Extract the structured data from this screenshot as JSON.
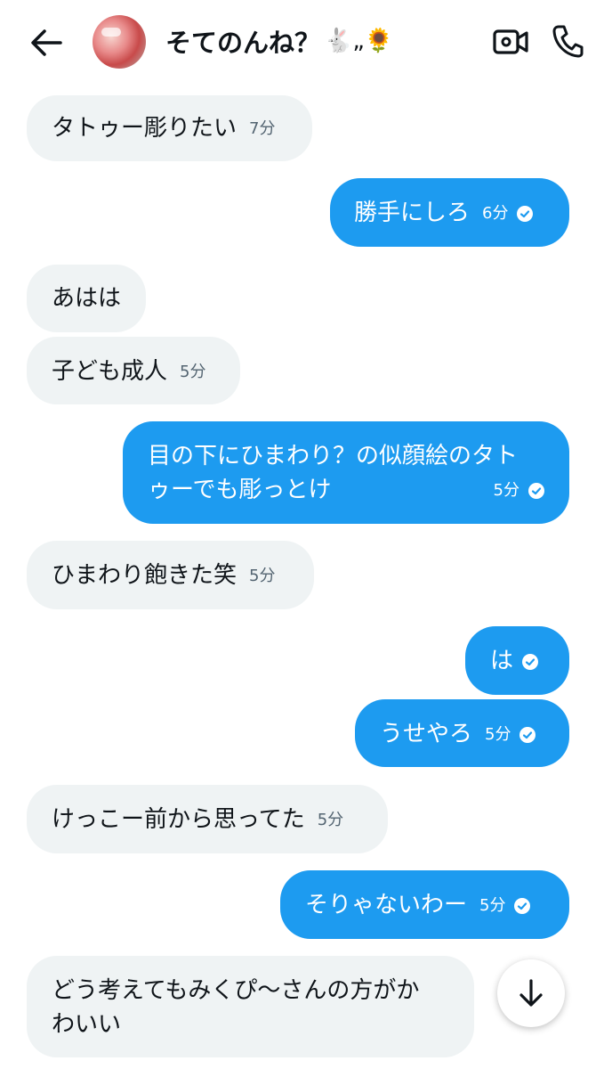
{
  "header": {
    "title": "そてのんね？",
    "title_emojis": "🐇„🌻"
  },
  "messages": [
    {
      "text": "タトゥー彫りたい",
      "time": "7分",
      "side": "in"
    },
    {
      "text": "勝手にしろ",
      "time": "6分",
      "side": "out"
    },
    {
      "text": "あはは",
      "time": "",
      "side": "in"
    },
    {
      "text": "子ども成人",
      "time": "5分",
      "side": "in"
    },
    {
      "text_line1": "目の下にひまわり？の似顔絵のタト",
      "text_line2": "ゥーでも彫っとけ",
      "time": "5分",
      "side": "out"
    },
    {
      "text": "ひまわり飽きた笑",
      "time": "5分",
      "side": "in"
    },
    {
      "text": "は",
      "time": "",
      "side": "out"
    },
    {
      "text": "うせやろ",
      "time": "5分",
      "side": "out"
    },
    {
      "text": "けっこー前から思ってた",
      "time": "5分",
      "side": "in"
    },
    {
      "text": "そりゃないわー",
      "time": "5分",
      "side": "out"
    },
    {
      "text_line1": "どう考えてもみくぴ〜さんの方がか",
      "text_line2": "わいい",
      "time": "",
      "side": "in"
    }
  ],
  "colors": {
    "accent": "#1d9bf0",
    "incoming_bubble": "#eff3f4",
    "text": "#0f1419",
    "secondary_text": "#536471"
  },
  "icons": [
    "back-arrow-icon",
    "avatar",
    "video-call-icon",
    "phone-icon",
    "read-check-icon",
    "arrow-down-icon"
  ]
}
